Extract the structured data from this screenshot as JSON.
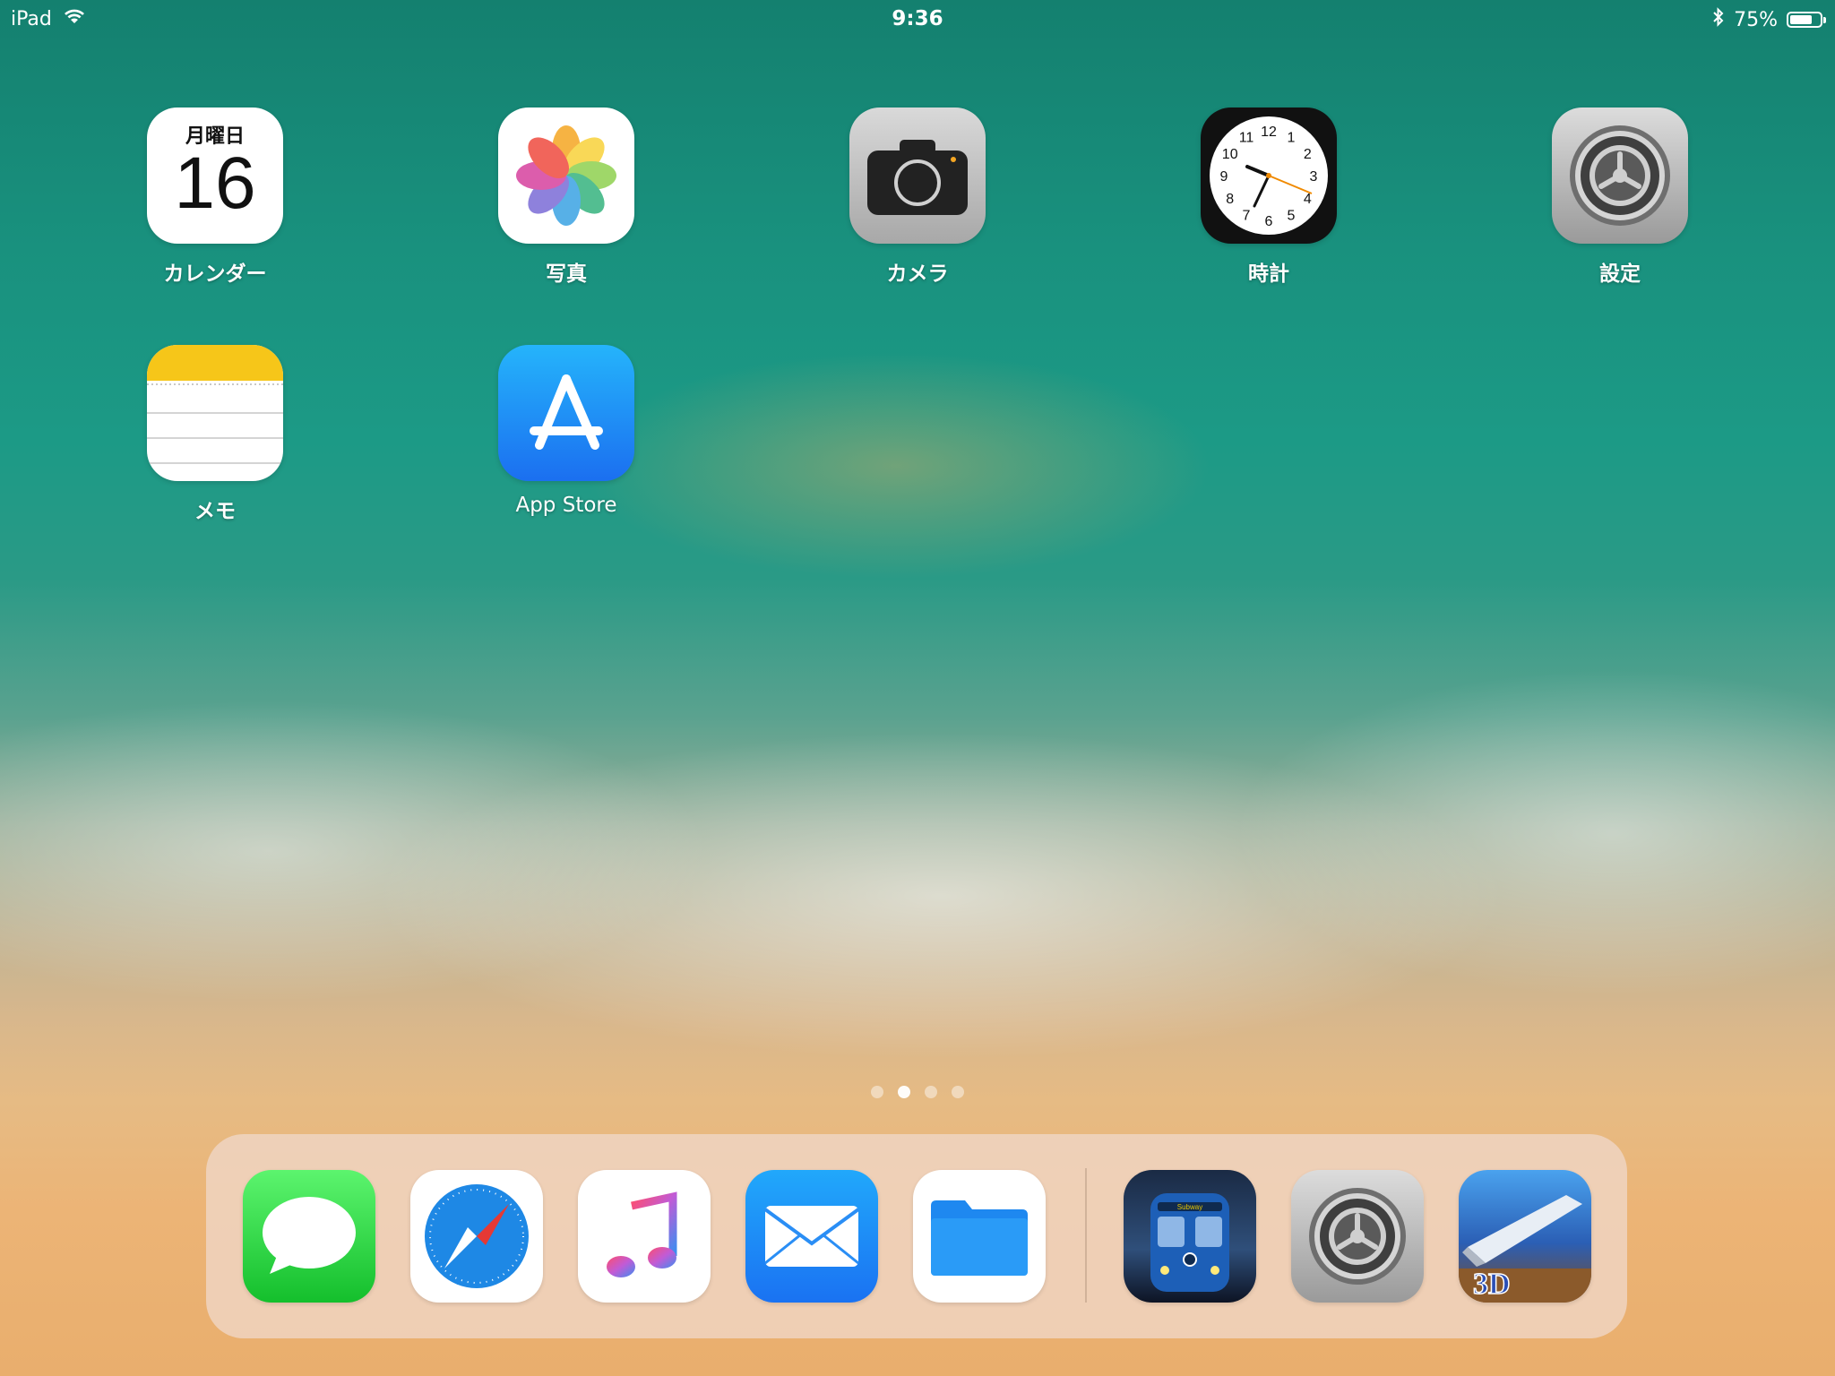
{
  "status_bar": {
    "device": "iPad",
    "time": "9:36",
    "battery_percent": "75%",
    "battery_level": 0.75,
    "icons": [
      "wifi-icon",
      "bluetooth-icon",
      "battery-icon"
    ]
  },
  "home": {
    "apps": [
      {
        "label": "カレンダー",
        "icon": "calendar-icon",
        "weekday": "月曜日",
        "day": "16"
      },
      {
        "label": "写真",
        "icon": "photos-icon"
      },
      {
        "label": "カメラ",
        "icon": "camera-icon"
      },
      {
        "label": "時計",
        "icon": "clock-icon",
        "clock_numbers": [
          "12",
          "1",
          "2",
          "3",
          "4",
          "5",
          "6",
          "7",
          "8",
          "9",
          "10",
          "11"
        ]
      },
      {
        "label": "設定",
        "icon": "settings-gear-icon"
      },
      {
        "label": "メモ",
        "icon": "notes-icon"
      },
      {
        "label": "App Store",
        "icon": "app-store-icon"
      }
    ]
  },
  "page_indicator": {
    "pages": 4,
    "current_page": 2
  },
  "dock": {
    "apps": [
      {
        "icon": "messages-icon"
      },
      {
        "icon": "safari-icon"
      },
      {
        "icon": "music-icon"
      },
      {
        "icon": "mail-icon"
      },
      {
        "icon": "files-icon"
      }
    ],
    "recent_apps": [
      {
        "icon": "subway-game-icon",
        "sign_text": "Subway"
      },
      {
        "icon": "settings-gear-icon"
      },
      {
        "icon": "train-3d-icon",
        "badge_text": "3D"
      }
    ]
  },
  "colors": {
    "calendar_text": "#111111",
    "app_store_blue": "#1b6ff0",
    "messages_green": "#14bf2c",
    "notes_yellow": "#f6c619",
    "clock_second_hand": "#f08a00"
  }
}
